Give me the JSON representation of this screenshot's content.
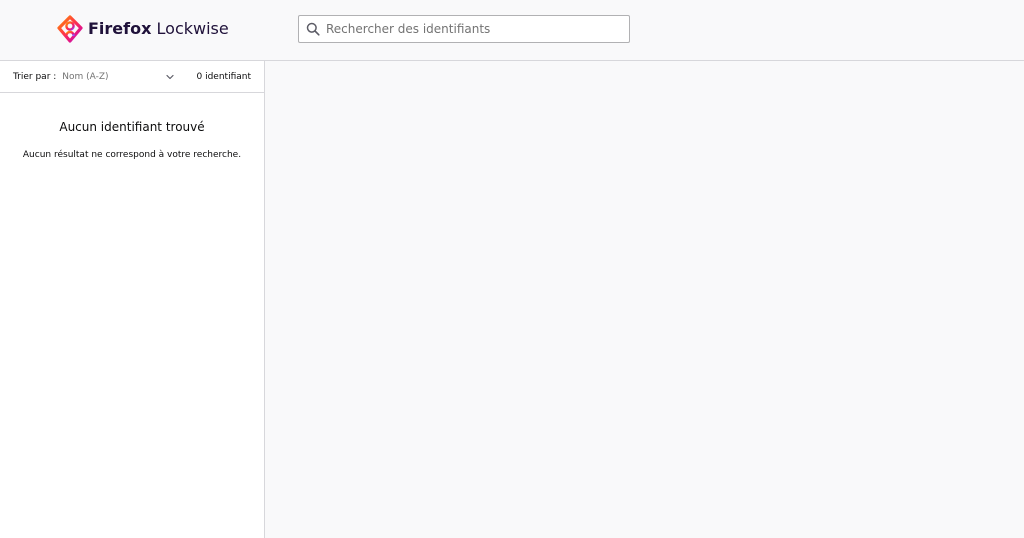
{
  "header": {
    "brand_strong": "Firefox",
    "brand_light": "Lockwise",
    "logo_icon": "lockwise-logo-icon",
    "search": {
      "placeholder": "Rechercher des identifiants",
      "value": "",
      "icon": "search-icon"
    }
  },
  "sidebar": {
    "sort_label": "Trier par :",
    "sort_value": "Nom (A-Z)",
    "count": "0 identifiant",
    "empty_title": "Aucun identifiant trouvé",
    "empty_text": "Aucun résultat ne correspond à votre recherche."
  },
  "colors": {
    "background": "#f9f9fa",
    "panel": "#ffffff",
    "border": "#d7d7db",
    "text": "#0c0c0d",
    "muted": "#737373",
    "brand_dark": "#20123a",
    "logo_gradient": [
      "#ff9100",
      "#ff3647",
      "#e31587",
      "#9059ff"
    ]
  }
}
